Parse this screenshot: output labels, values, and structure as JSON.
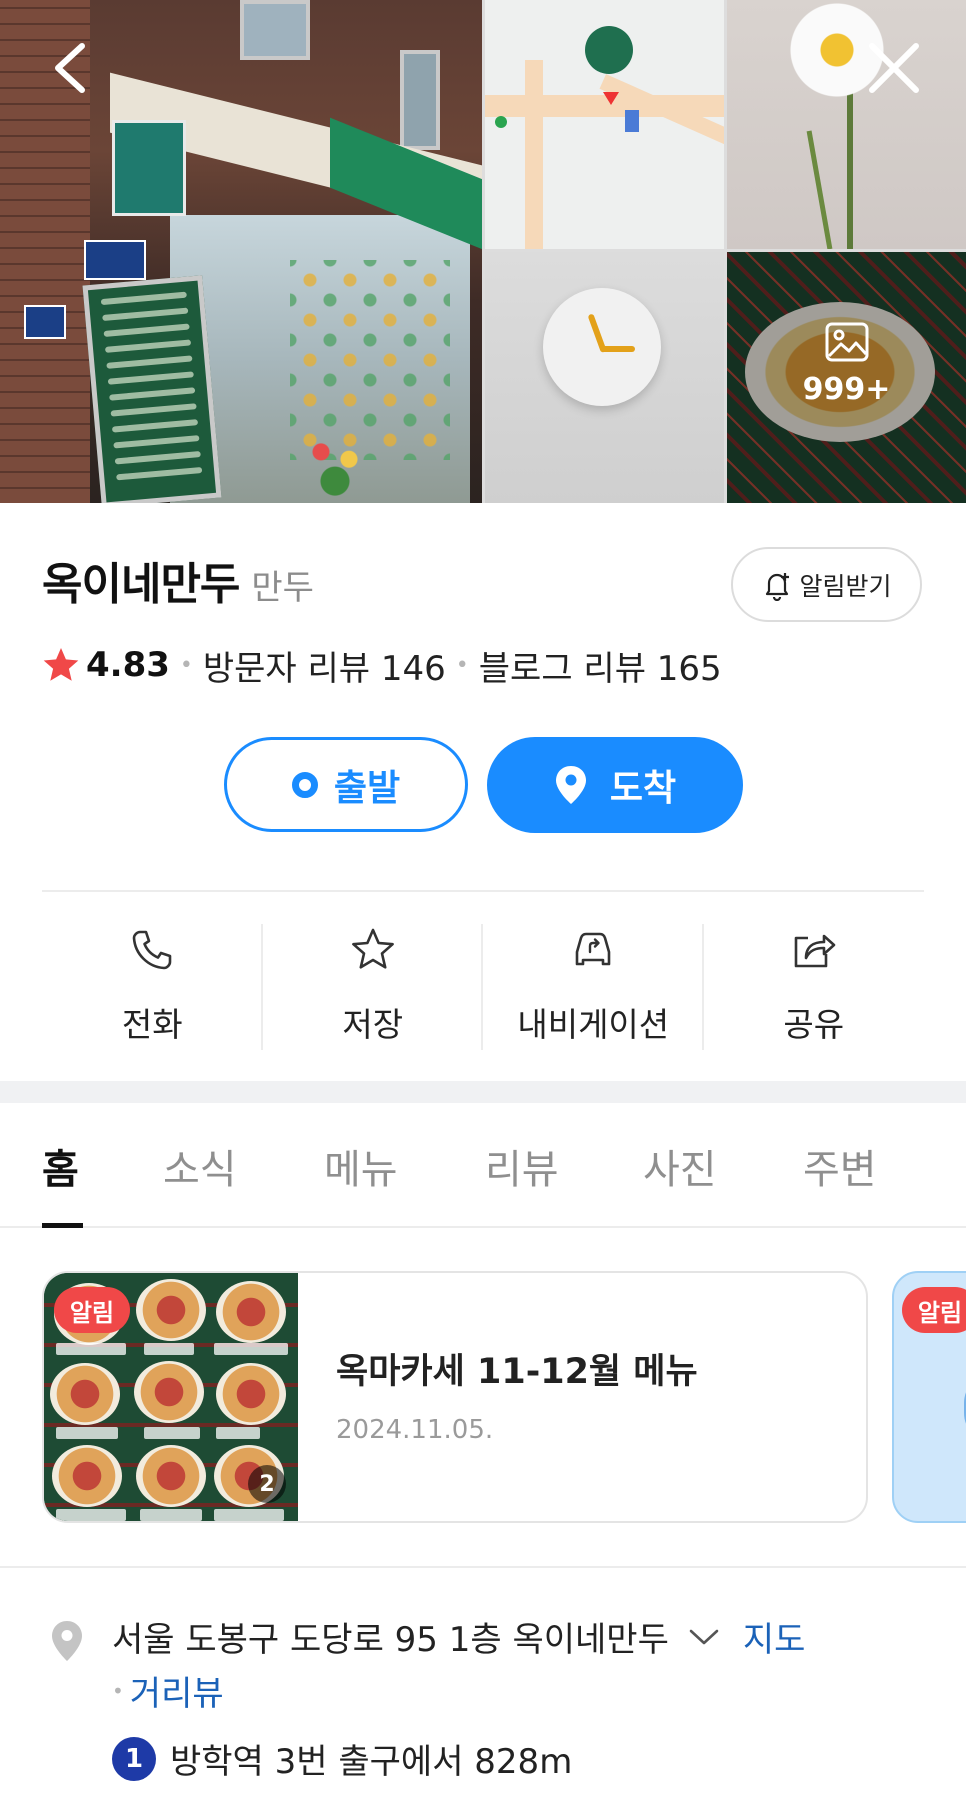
{
  "gallery": {
    "more_count": "999+"
  },
  "place": {
    "name": "옥이네만두",
    "category": "만두",
    "alert_label": "알림받기"
  },
  "rating": {
    "score": "4.83",
    "visitor_reviews": "방문자 리뷰 146",
    "blog_reviews": "블로그 리뷰 165"
  },
  "route": {
    "depart_label": "출발",
    "arrive_label": "도착"
  },
  "actions": [
    {
      "label": "전화",
      "icon": "phone-icon"
    },
    {
      "label": "저장",
      "icon": "star-outline-icon"
    },
    {
      "label": "내비게이션",
      "icon": "car-navigation-icon"
    },
    {
      "label": "공유",
      "icon": "share-icon"
    }
  ],
  "tabs": [
    {
      "label": "홈",
      "active": true
    },
    {
      "label": "소식",
      "active": false
    },
    {
      "label": "메뉴",
      "active": false
    },
    {
      "label": "리뷰",
      "active": false
    },
    {
      "label": "사진",
      "active": false
    },
    {
      "label": "주변",
      "active": false
    }
  ],
  "notices": [
    {
      "badge": "알림",
      "title": "옥마카세 11-12월 메뉴",
      "date": "2024.11.05.",
      "image_count": "2"
    },
    {
      "badge": "알림"
    }
  ],
  "address": {
    "text": "서울 도봉구 도당로 95 1층 옥이네만두",
    "map_link": "지도",
    "street_view_link": "거리뷰",
    "subway_line": "1",
    "subway_text": "방학역 3번 출구에서 828m"
  },
  "colors": {
    "primary_blue": "#1a8cff",
    "star_red": "#f04848",
    "link_blue": "#1b62b8",
    "line1_badge": "#1e3aa7"
  }
}
